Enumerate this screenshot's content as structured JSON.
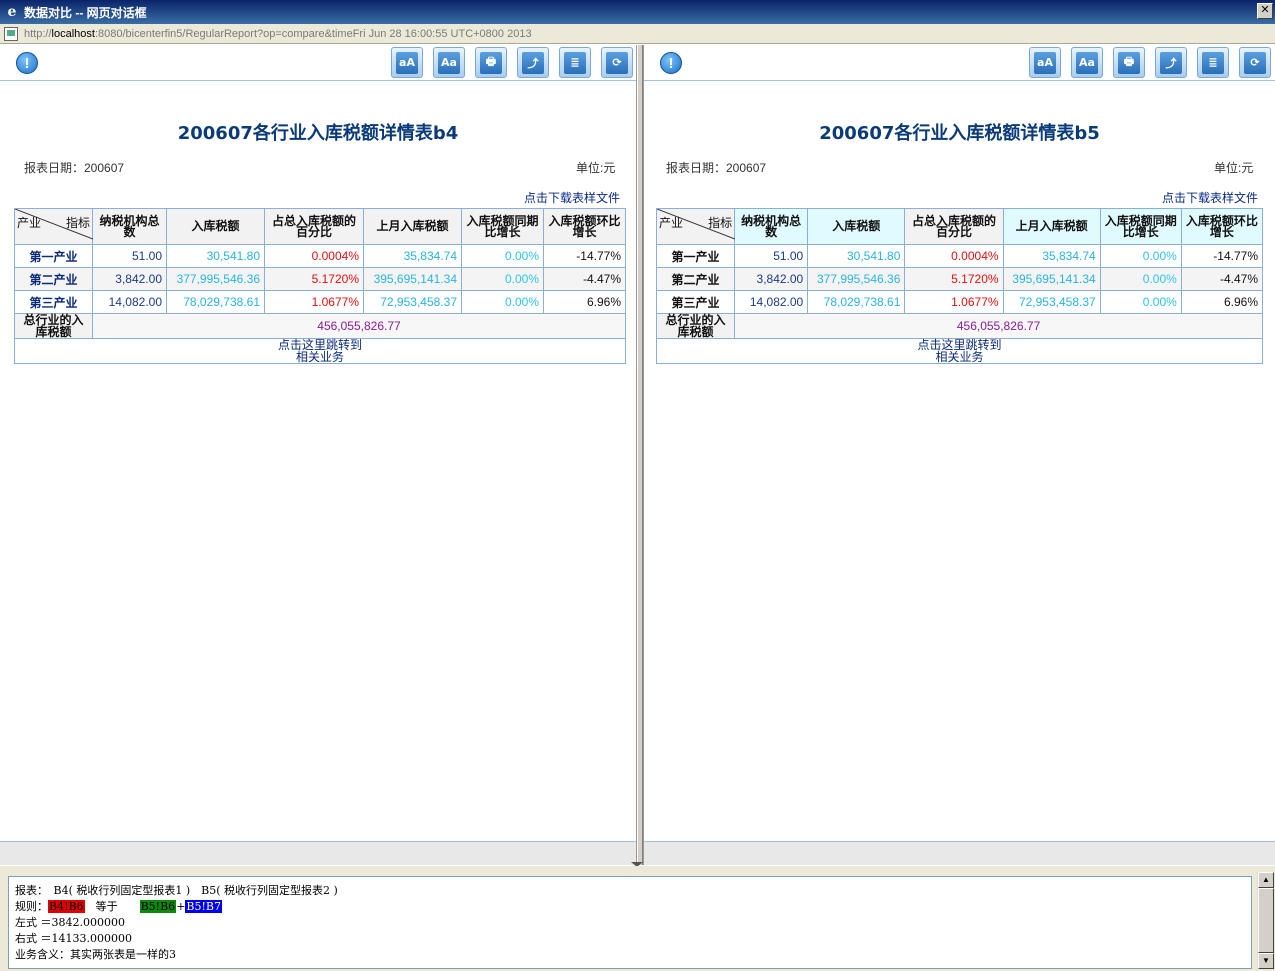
{
  "window": {
    "title": "数据对比 -- 网页对话框",
    "close_label": "✕",
    "address_prefix": "http://",
    "address_host": "localhost",
    "address_rest": ":8080/bicenterfin5/RegularReport?op=compare&timeFri Jun 28 16:00:55 UTC+0800 2013"
  },
  "toolbar": {
    "buttons": [
      {
        "icon": "font-decrease-icon",
        "glyph": "aA"
      },
      {
        "icon": "font-increase-icon",
        "glyph": "Aa"
      },
      {
        "icon": "print-icon",
        "glyph": "🖶"
      },
      {
        "icon": "pdf-export-icon",
        "glyph": "⤴"
      },
      {
        "icon": "excel-export-icon",
        "glyph": "≣"
      },
      {
        "icon": "refresh-icon",
        "glyph": "⟳"
      }
    ],
    "info_glyph": "!"
  },
  "left": {
    "title": "200607各行业入库税额详情表b4",
    "date_label": "报表日期：200607",
    "unit_label": "单位:元",
    "download_link": "点击下载表样文件",
    "corner_top": "指标",
    "corner_bottom": "产业",
    "headers": [
      "纳税机构总数",
      "入库税额",
      "占总入库税额的百分比",
      "上月入库税额",
      "入库税额同期比增长",
      "入库税额环比增长"
    ],
    "rows": [
      {
        "name": "第一产业",
        "cells": [
          "51.00",
          "30,541.80",
          "0.0004%",
          "35,834.74",
          "0.00%",
          "-14.77%"
        ]
      },
      {
        "name": "第二产业",
        "cells": [
          "3,842.00",
          "377,995,546.36",
          "5.1720%",
          "395,695,141.34",
          "0.00%",
          "-4.47%"
        ]
      },
      {
        "name": "第三产业",
        "cells": [
          "14,082.00",
          "78,029,738.61",
          "1.0677%",
          "72,953,458.37",
          "0.00%",
          "6.96%"
        ]
      }
    ],
    "total_label": "总行业的入库税额",
    "total_value": "456,055,826.77",
    "jump_line1": "点击这里跳转到",
    "jump_line2": "相关业务"
  },
  "right": {
    "title": "200607各行业入库税额详情表b5",
    "date_label": "报表日期：200607",
    "unit_label": "单位:元",
    "download_link": "点击下载表样文件",
    "corner_top": "指标",
    "corner_bottom": "产业",
    "headers": [
      "纳税机构总数",
      "入库税额",
      "占总入库税额的百分比",
      "上月入库税额",
      "入库税额同期比增长",
      "入库税额环比增长"
    ],
    "rows": [
      {
        "name": "第一产业",
        "cells": [
          "51.00",
          "30,541.80",
          "0.0004%",
          "35,834.74",
          "0.00%",
          "-14.77%"
        ]
      },
      {
        "name": "第二产业",
        "cells": [
          "3,842.00",
          "377,995,546.36",
          "5.1720%",
          "395,695,141.34",
          "0.00%",
          "-4.47%"
        ]
      },
      {
        "name": "第三产业",
        "cells": [
          "14,082.00",
          "78,029,738.61",
          "1.0677%",
          "72,953,458.37",
          "0.00%",
          "6.96%"
        ]
      }
    ],
    "total_label": "总行业的入库税额",
    "total_value": "456,055,826.77",
    "jump_line1": "点击这里跳转到",
    "jump_line2": "相关业务"
  },
  "info": {
    "reports_line": "报表：　B4( 税收行列固定型报表1 )　B5( 税收行列固定型报表2 )",
    "rule_label": "规则：",
    "rule_left": "B4!B6",
    "rule_equals": "　等于　　",
    "rule_right_a": "B5!B6",
    "rule_plus": "+",
    "rule_right_b": "B5!B7",
    "left_expr": "左式 ＝3842.000000",
    "right_expr": "右式 ＝14133.000000",
    "meaning": "业务含义：其实两张表是一样的3"
  },
  "colors": {
    "title_bar": "#0a246a",
    "title_text": "#0a3a7a",
    "link": "#0a2a8a",
    "cyan_value": "#28b4e0",
    "red_value": "#e01010",
    "total_value": "#8a1a9a",
    "rule_red": "#e00000",
    "rule_green": "#0a8a0a",
    "rule_blue": "#0000ee"
  }
}
